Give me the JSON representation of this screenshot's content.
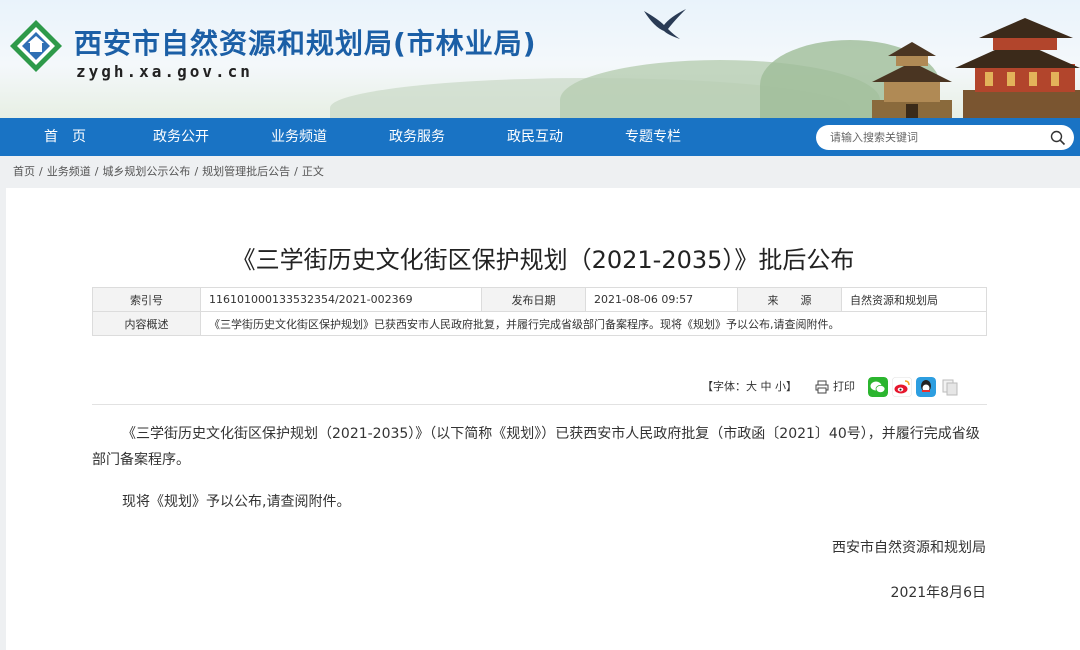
{
  "site": {
    "title": "西安市自然资源和规划局(市林业局)",
    "url": "zygh.xa.gov.cn"
  },
  "nav": {
    "items": [
      "首　页",
      "政务公开",
      "业务频道",
      "政务服务",
      "政民互动",
      "专题专栏"
    ],
    "search_placeholder": "请输入搜索关键词"
  },
  "breadcrumb": [
    "首页",
    "业务频道",
    "城乡规划公示公布",
    "规划管理批后公告",
    "正文"
  ],
  "article": {
    "title": "《三学街历史文化街区保护规划（2021-2035）》批后公布",
    "meta": {
      "index_label": "索引号",
      "index_value": "116101000133532354/2021-002369",
      "date_label": "发布日期",
      "date_value": "2021-08-06 09:57",
      "source_label": "来　　源",
      "source_value": "自然资源和规划局",
      "summary_label": "内容概述",
      "summary_value": "《三学街历史文化街区保护规划》已获西安市人民政府批复，并履行完成省级部门备案程序。现将《规划》予以公布,请查阅附件。"
    },
    "tools": {
      "font_prefix": "【字体：",
      "font_large": "大",
      "font_medium": "中",
      "font_small": "小",
      "font_suffix": "】",
      "print_label": "打印"
    },
    "body": [
      "《三学街历史文化街区保护规划（2021-2035）》（以下简称《规划》）已获西安市人民政府批复（市政函〔2021〕40号），并履行完成省级部门备案程序。",
      "现将《规划》予以公布,请查阅附件。"
    ],
    "signature_org": "西安市自然资源和规划局",
    "signature_date": "2021年8月6日"
  },
  "colors": {
    "nav_bg": "#1973c4",
    "title_blue": "#1b5fa6",
    "page_bg": "#eef0f2"
  },
  "icons": [
    "site-logo-icon",
    "swallow-bird-icon",
    "pagoda-icon",
    "temple-icon",
    "search-icon",
    "print-icon",
    "wechat-icon",
    "weibo-icon",
    "qq-icon",
    "copy-icon"
  ]
}
